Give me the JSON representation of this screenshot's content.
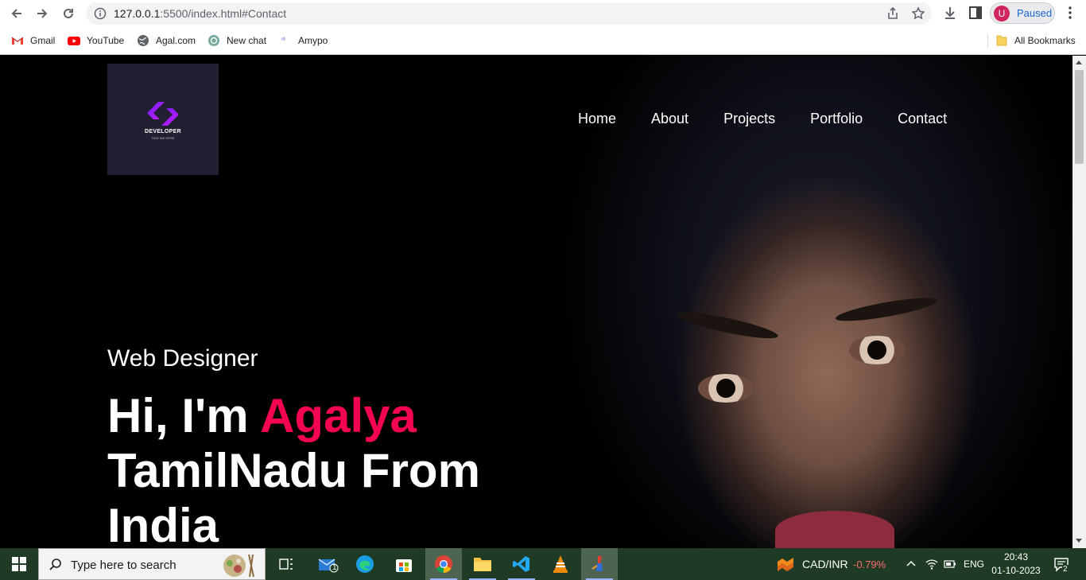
{
  "browser": {
    "url_host": "127.0.0.1",
    "url_rest": ":5500/index.html#Contact",
    "profile_initial": "U",
    "profile_status": "Paused"
  },
  "bookmarks": {
    "items": [
      {
        "label": "Gmail",
        "icon": "gmail-icon"
      },
      {
        "label": "YouTube",
        "icon": "youtube-icon"
      },
      {
        "label": "Agal.com",
        "icon": "globe-icon"
      },
      {
        "label": "New chat",
        "icon": "chatgpt-icon"
      },
      {
        "label": "Amypo",
        "icon": "amypo-icon"
      }
    ],
    "all_bookmarks": "All Bookmarks"
  },
  "site": {
    "logo_text": "DEVELOPER",
    "logo_tagline": "TAGLINE HERE",
    "nav": [
      "Home",
      "About",
      "Projects",
      "Portfolio",
      "Contact"
    ],
    "role": "Web Designer",
    "greeting": "Hi, I'm",
    "name": "Agalya",
    "line2": "TamilNadu From",
    "line3": "India",
    "accent_color": "#f5054f"
  },
  "taskbar": {
    "search_placeholder": "Type here to search",
    "ticker": "CAD/INR",
    "ticker_change": "-0.79%",
    "language": "ENG",
    "time": "20:43",
    "date": "01-10-2023",
    "mail_badge": "1",
    "notification_count": "2"
  }
}
